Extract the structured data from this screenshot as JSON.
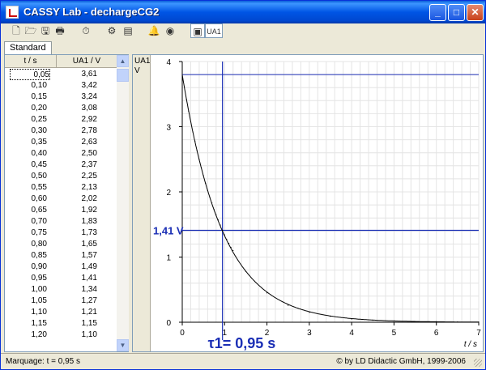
{
  "window": {
    "title": "CASSY Lab - dechargeCG2",
    "minimize": "_",
    "maximize": "□",
    "close": "✕"
  },
  "toolbar": {
    "tools": [
      {
        "name": "new-icon",
        "glyph": "🗋"
      },
      {
        "name": "open-icon",
        "glyph": "🗁"
      },
      {
        "name": "save-icon",
        "glyph": "🖫"
      },
      {
        "name": "print-icon",
        "glyph": "🖶"
      },
      {
        "name": "stopwatch-icon",
        "glyph": "⏱"
      },
      {
        "name": "settings-icon",
        "glyph": "⚙"
      },
      {
        "name": "display-icon",
        "glyph": "▤"
      },
      {
        "name": "bell-icon",
        "glyph": "🔔"
      },
      {
        "name": "meter-icon",
        "glyph": "◉"
      },
      {
        "name": "window-icon",
        "glyph": "▣"
      },
      {
        "name": "ua1-icon",
        "glyph": "UA1"
      }
    ]
  },
  "tabs": [
    {
      "label": "Standard"
    }
  ],
  "table": {
    "col_t": "t / s",
    "col_u": "UA1 / V",
    "rows": [
      [
        "0,05",
        "3,61"
      ],
      [
        "0,10",
        "3,42"
      ],
      [
        "0,15",
        "3,24"
      ],
      [
        "0,20",
        "3,08"
      ],
      [
        "0,25",
        "2,92"
      ],
      [
        "0,30",
        "2,78"
      ],
      [
        "0,35",
        "2,63"
      ],
      [
        "0,40",
        "2,50"
      ],
      [
        "0,45",
        "2,37"
      ],
      [
        "0,50",
        "2,25"
      ],
      [
        "0,55",
        "2,13"
      ],
      [
        "0,60",
        "2,02"
      ],
      [
        "0,65",
        "1,92"
      ],
      [
        "0,70",
        "1,83"
      ],
      [
        "0,75",
        "1,73"
      ],
      [
        "0,80",
        "1,65"
      ],
      [
        "0,85",
        "1,57"
      ],
      [
        "0,90",
        "1,49"
      ],
      [
        "0,95",
        "1,41"
      ],
      [
        "1,00",
        "1,34"
      ],
      [
        "1,05",
        "1,27"
      ],
      [
        "1,10",
        "1,21"
      ],
      [
        "1,15",
        "1,15"
      ],
      [
        "1,20",
        "1,10"
      ]
    ]
  },
  "chart": {
    "y_label_top": "UA1",
    "y_label_unit": "V",
    "x_label": "t / s",
    "x_ticks": [
      "0",
      "1",
      "2",
      "3",
      "4",
      "5",
      "6",
      "7"
    ],
    "y_ticks": [
      "0",
      "1",
      "2",
      "3",
      "4"
    ],
    "marker_value_label": "1,41 V",
    "tau_label": "τ1= 0,95 s",
    "accent": "#1b2fb5"
  },
  "chart_data": {
    "type": "line",
    "xlim": [
      0,
      7
    ],
    "ylim": [
      0,
      4
    ],
    "xlabel": "t / s",
    "ylabel": "UA1 / V",
    "grid": true,
    "x": [
      0.05,
      0.1,
      0.15,
      0.2,
      0.25,
      0.3,
      0.35,
      0.4,
      0.45,
      0.5,
      0.55,
      0.6,
      0.65,
      0.7,
      0.75,
      0.8,
      0.85,
      0.9,
      0.95,
      1.0,
      1.05,
      1.1,
      1.15,
      1.2,
      1.5,
      2.0,
      2.5,
      3.0,
      3.5,
      4.0,
      4.5,
      5.0,
      5.5,
      6.0,
      6.5,
      7.0
    ],
    "values": [
      3.61,
      3.42,
      3.24,
      3.08,
      2.92,
      2.78,
      2.63,
      2.5,
      2.37,
      2.25,
      2.13,
      2.02,
      1.92,
      1.83,
      1.73,
      1.65,
      1.57,
      1.49,
      1.41,
      1.34,
      1.27,
      1.21,
      1.15,
      1.1,
      0.78,
      0.45,
      0.26,
      0.15,
      0.09,
      0.05,
      0.03,
      0.02,
      0.01,
      0.01,
      0.005,
      0.003
    ],
    "markers": {
      "h_line_top": 3.8,
      "h_line_marker": 1.41,
      "v_line_marker": 0.95
    },
    "annotations": [
      "1,41 V",
      "τ1= 0,95 s"
    ]
  },
  "statusbar": {
    "left": "Marquage:  t = 0,95 s",
    "right": "© by LD Didactic GmbH, 1999-2006"
  }
}
